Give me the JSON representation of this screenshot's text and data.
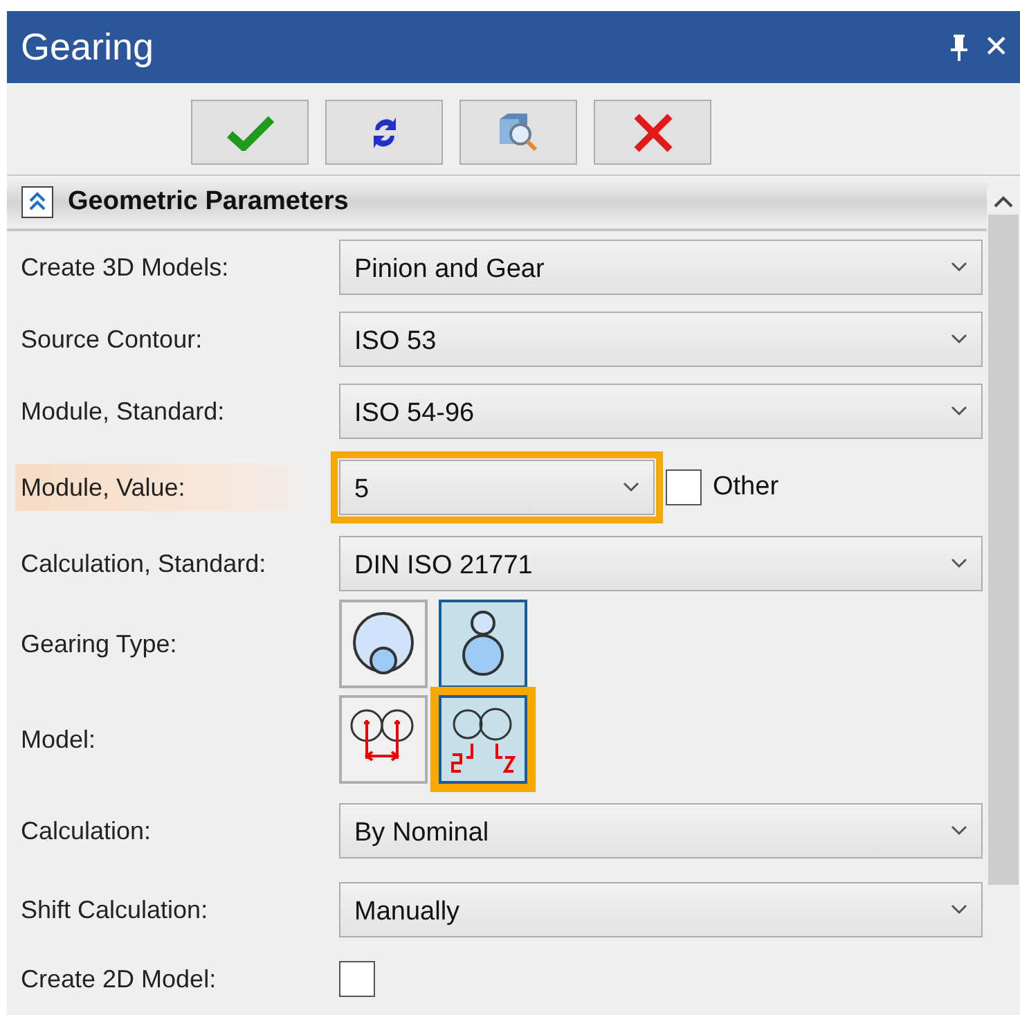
{
  "window": {
    "title": "Gearing",
    "close_glyph": "✕"
  },
  "toolbar": [
    {
      "kind": "ok"
    },
    {
      "kind": "refresh"
    },
    {
      "kind": "preview"
    },
    {
      "kind": "cancel"
    }
  ],
  "section": {
    "title": "Geometric Parameters",
    "expanded": true
  },
  "rows": [
    {
      "kind": "dropdown",
      "label": "Create 3D Models:",
      "value": "Pinion and Gear",
      "highlighted": false
    },
    {
      "kind": "dropdown",
      "label": "Source Contour:",
      "value": "ISO 53",
      "highlighted": false
    },
    {
      "kind": "dropdown",
      "label": "Module, Standard:",
      "value": "ISO 54-96",
      "highlighted": false
    },
    {
      "kind": "dropdown_check",
      "label": "Module, Value:",
      "value": "5",
      "highlighted": true,
      "check_label": "Other",
      "checked": false
    },
    {
      "kind": "dropdown",
      "label": "Calculation, Standard:",
      "value": "DIN ISO 21771",
      "highlighted": false
    },
    {
      "kind": "image_choice",
      "label": "Gearing Type:",
      "highlighted": false,
      "options": [
        {
          "kind": "internal",
          "selected": false,
          "highlighted": false
        },
        {
          "kind": "external",
          "selected": true,
          "highlighted": false
        }
      ]
    },
    {
      "kind": "image_choice",
      "label": "Model:",
      "highlighted": false,
      "options": [
        {
          "kind": "center_distance",
          "selected": false,
          "highlighted": false
        },
        {
          "kind": "teeth",
          "selected": true,
          "highlighted": true
        }
      ]
    },
    {
      "kind": "dropdown",
      "label": "Calculation:",
      "value": "By Nominal",
      "highlighted": false
    },
    {
      "kind": "dropdown",
      "label": "Shift Calculation:",
      "value": "Manually",
      "highlighted": false
    },
    {
      "kind": "checkbox",
      "label": "Create 2D Model:",
      "highlighted": false,
      "checked": false
    }
  ]
}
